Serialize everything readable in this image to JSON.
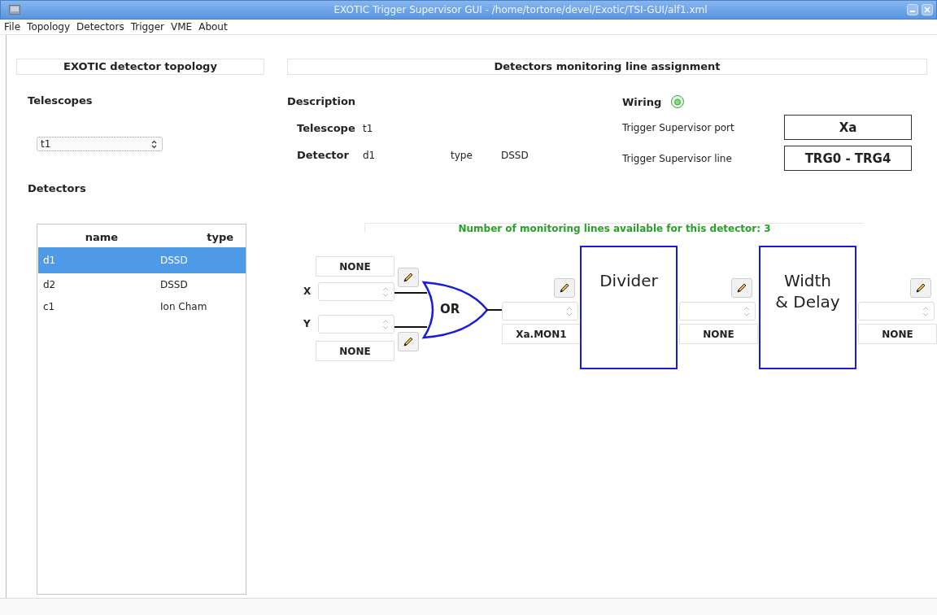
{
  "window": {
    "title": "EXOTIC Trigger Supervisor GUI - /home/tortone/devel/Exotic/TSI-GUI/alf1.xml"
  },
  "menu": [
    "File",
    "Topology",
    "Detectors",
    "Trigger",
    "VME",
    "About"
  ],
  "left_panel": {
    "header": "EXOTIC detector topology",
    "telescopes_label": "Telescopes",
    "telescope_select": {
      "value": "t1"
    },
    "detectors_label": "Detectors",
    "detectors_table": {
      "columns": [
        "name",
        "type"
      ],
      "rows": [
        {
          "name": "d1",
          "type": "DSSD",
          "selected": true
        },
        {
          "name": "d2",
          "type": "DSSD",
          "selected": false
        },
        {
          "name": "c1",
          "type": "Ion Cham",
          "selected": false
        }
      ]
    }
  },
  "right_panel": {
    "header": "Detectors monitoring line assignment",
    "description_label": "Description",
    "telescope_label": "Telescope",
    "telescope_value": "t1",
    "detector_label": "Detector",
    "detector_value": "d1",
    "type_label": "type",
    "type_value": "DSSD",
    "wiring_label": "Wiring",
    "wiring_ok": true,
    "port_label": "Trigger Supervisor port",
    "port_value": "Xa",
    "line_label": "Trigger Supervisor line",
    "line_value": "TRG0 - TRG4"
  },
  "diagram": {
    "available_lines": "Number of monitoring lines available for this detector: 3",
    "inputs": [
      {
        "label": "X",
        "line": "NONE"
      },
      {
        "label": "Y",
        "line": "NONE"
      }
    ],
    "gate": "OR",
    "blocks": [
      "Divider",
      "Width\n& Delay"
    ],
    "outputs": [
      "Xa.MON1",
      "NONE",
      "NONE"
    ]
  }
}
